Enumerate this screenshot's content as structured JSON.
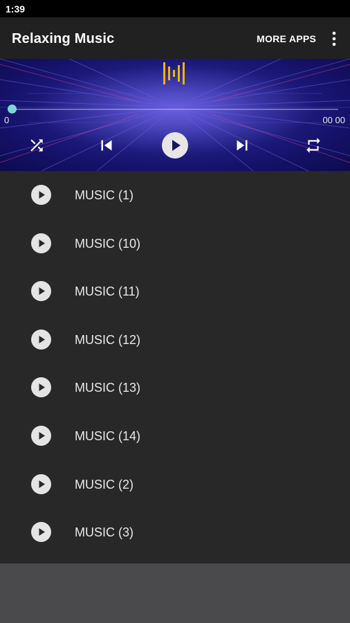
{
  "status_bar": {
    "time": "1:39"
  },
  "app_bar": {
    "title": "Relaxing Music",
    "more_apps_label": "MORE APPS",
    "menu_icon": "more-vert-icon"
  },
  "player": {
    "eq_icon": "equalizer-icon",
    "progress": 0,
    "time_elapsed": "0",
    "time_total": "00 00",
    "controls": [
      "shuffle-icon",
      "skip-previous-icon",
      "play-icon",
      "skip-next-icon",
      "repeat-icon"
    ],
    "accent_color": "#7fd5d8"
  },
  "tracks": [
    {
      "label": "MUSIC (1)"
    },
    {
      "label": "MUSIC (10)"
    },
    {
      "label": "MUSIC (11)"
    },
    {
      "label": "MUSIC (12)"
    },
    {
      "label": "MUSIC (13)"
    },
    {
      "label": "MUSIC (14)"
    },
    {
      "label": "MUSIC (2)"
    },
    {
      "label": "MUSIC (3)"
    }
  ]
}
